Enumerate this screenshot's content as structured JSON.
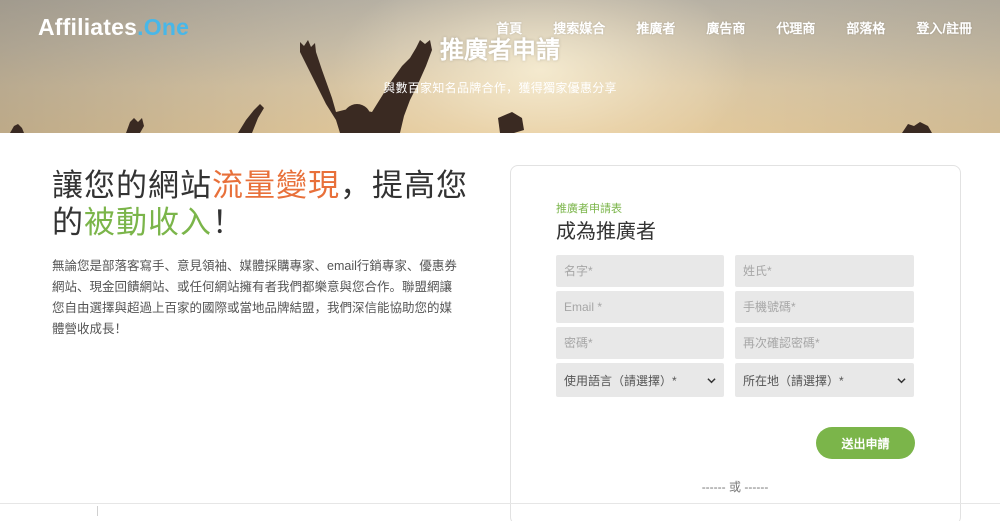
{
  "brand": {
    "logo_main": "Affiliates",
    "logo_dot": ".",
    "logo_one": "One"
  },
  "nav": {
    "items": [
      "首頁",
      "搜索媒合",
      "推廣者",
      "廣告商",
      "代理商",
      "部落格",
      "登入/註冊"
    ]
  },
  "hero": {
    "title": "推廣者申請",
    "subtitle": "與數百家知名品牌合作，獲得獨家優惠分享"
  },
  "intro": {
    "headline_part1": "讓您的網站",
    "headline_highlight1": "流量變現",
    "headline_part2": "，提高您的",
    "headline_highlight2": "被動收入",
    "headline_part3": "！",
    "description": "無論您是部落客寫手、意見領袖、媒體採購專家、email行銷專家、優惠券網站、現金回饋網站、或任何網站擁有者我們都樂意與您合作。聯盟網讓您自由選擇與超過上百家的國際或當地品牌結盟，我們深信能協助您的媒體營收成長！"
  },
  "form": {
    "kicker": "推廣者申請表",
    "title": "成為推廣者",
    "first_name_placeholder": "名字*",
    "last_name_placeholder": "姓氏*",
    "email_placeholder": "Email *",
    "phone_placeholder": "手機號碼*",
    "password_placeholder": "密碼*",
    "password_confirm_placeholder": "再次確認密碼*",
    "language_select": "使用語言（請選擇）*",
    "location_select": "所在地（請選擇）*",
    "submit_label": "送出申請",
    "or_divider": "------ 或 ------"
  },
  "colors": {
    "accent_green": "#7bb54a",
    "accent_orange": "#e8703a",
    "logo_blue": "#48b7e8",
    "field_bg": "#e8e8e8"
  }
}
